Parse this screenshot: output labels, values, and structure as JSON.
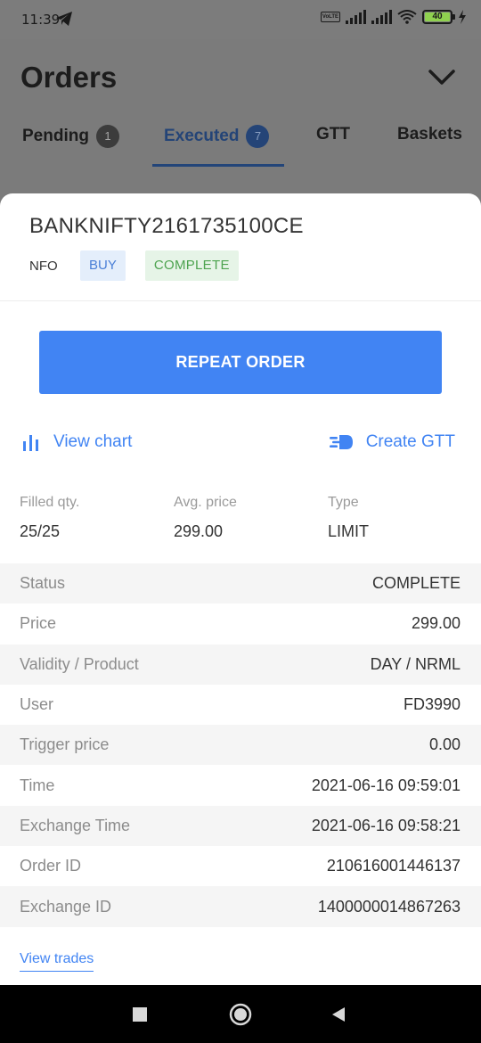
{
  "status_bar": {
    "time": "11:39",
    "volte": "VoLTE",
    "battery": "40",
    "icons": [
      "telegram-icon",
      "signal-icon",
      "wifi-icon",
      "battery-icon",
      "charging-icon"
    ]
  },
  "page": {
    "title": "Orders",
    "tabs": [
      {
        "label": "Pending",
        "count": "1"
      },
      {
        "label": "Executed",
        "count": "7"
      },
      {
        "label": "GTT"
      },
      {
        "label": "Baskets"
      }
    ]
  },
  "order": {
    "symbol": "BANKNIFTY2161735100CE",
    "exchange": "NFO",
    "side": "BUY",
    "status_chip": "COMPLETE",
    "repeat_label": "REPEAT ORDER",
    "view_chart_label": "View chart",
    "create_gtt_label": "Create GTT",
    "stats": [
      {
        "label": "Filled qty.",
        "value": "25/25"
      },
      {
        "label": "Avg. price",
        "value": "299.00"
      },
      {
        "label": "Type",
        "value": "LIMIT"
      }
    ],
    "details": [
      {
        "key": "Status",
        "value": "COMPLETE"
      },
      {
        "key": "Price",
        "value": "299.00"
      },
      {
        "key": "Validity / Product",
        "value": "DAY / NRML"
      },
      {
        "key": "User",
        "value": "FD3990"
      },
      {
        "key": "Trigger price",
        "value": "0.00"
      },
      {
        "key": "Time",
        "value": "2021-06-16 09:59:01"
      },
      {
        "key": "Exchange Time",
        "value": "2021-06-16 09:58:21"
      },
      {
        "key": "Order ID",
        "value": "210616001446137"
      },
      {
        "key": "Exchange ID",
        "value": "1400000014867263"
      }
    ],
    "view_trades_label": "View trades"
  },
  "colors": {
    "accent": "#4184f3",
    "buy_bg": "#e4eefb",
    "complete_bg": "#e6f4e7",
    "complete_text": "#4da34f"
  }
}
